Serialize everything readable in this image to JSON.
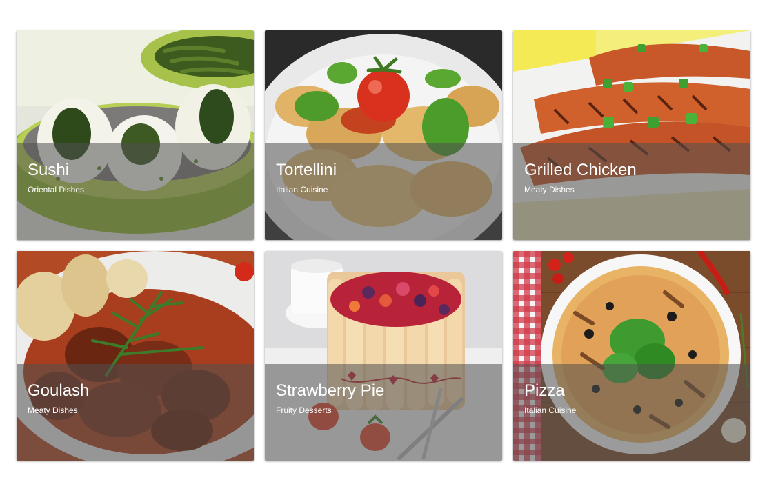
{
  "cards": [
    {
      "title": "Sushi",
      "subtitle": "Oriental Dishes",
      "image": "sushi-rolls-in-green-bowl"
    },
    {
      "title": "Tortellini",
      "subtitle": "Italian Cuisine",
      "image": "tortellini-with-tomato-and-basil"
    },
    {
      "title": "Grilled Chicken",
      "subtitle": "Meaty Dishes",
      "image": "grilled-chicken-with-green-onions"
    },
    {
      "title": "Goulash",
      "subtitle": "Meaty Dishes",
      "image": "goulash-with-rosemary-and-dumplings"
    },
    {
      "title": "Strawberry Pie",
      "subtitle": "Fruity Desserts",
      "image": "berry-charlotte-cake"
    },
    {
      "title": "Pizza",
      "subtitle": "Italian Cuisine",
      "image": "pizza-with-spinach-and-olives"
    }
  ]
}
